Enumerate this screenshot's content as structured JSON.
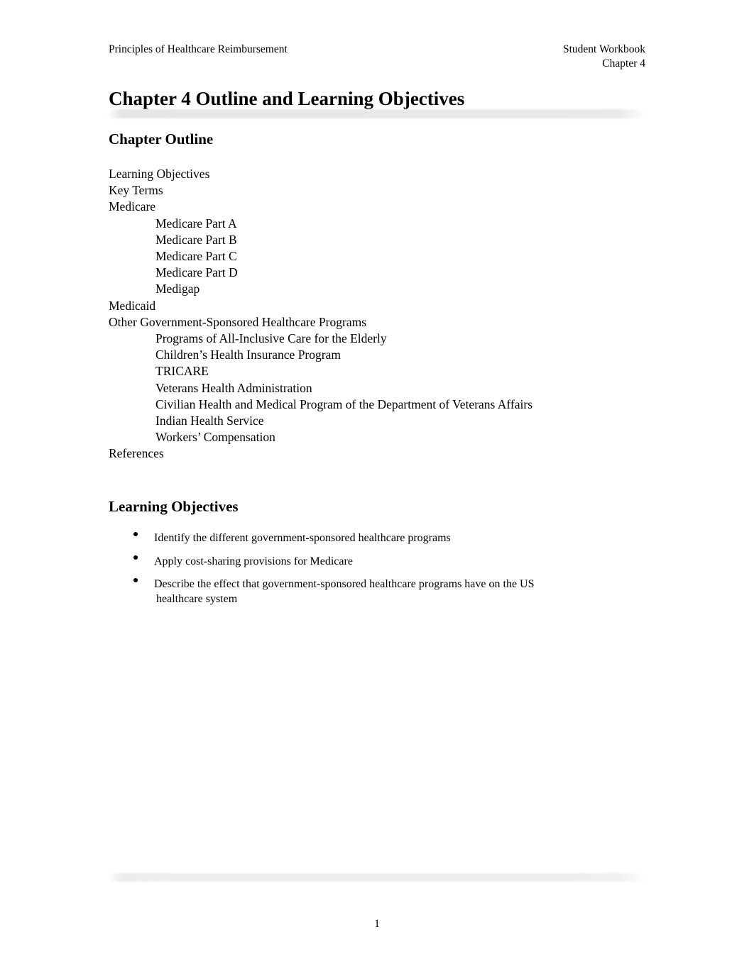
{
  "document": {
    "header": {
      "left": "Principles of Healthcare Reimbursement",
      "right_line1": "Student Workbook",
      "right_line2": "Chapter 4"
    },
    "title": "Chapter 4 Outline and Learning Objectives",
    "footer": {
      "page_number": "1"
    },
    "sections": {
      "chapter_outline": {
        "heading": "Chapter Outline",
        "items": [
          {
            "level": 0,
            "text": "Learning Objectives"
          },
          {
            "level": 0,
            "text": "Key Terms"
          },
          {
            "level": 0,
            "text": "Medicare"
          },
          {
            "level": 1,
            "text": "Medicare Part A"
          },
          {
            "level": 1,
            "text": "Medicare Part B"
          },
          {
            "level": 1,
            "text": "Medicare Part C"
          },
          {
            "level": 1,
            "text": "Medicare Part D"
          },
          {
            "level": 1,
            "text": "Medigap"
          },
          {
            "level": 0,
            "text": "Medicaid"
          },
          {
            "level": 0,
            "text": "Other Government-Sponsored Healthcare Programs"
          },
          {
            "level": 1,
            "text": "Programs of All-Inclusive Care for the Elderly"
          },
          {
            "level": 1,
            "text": "Children’s Health Insurance Program"
          },
          {
            "level": 1,
            "text": "TRICARE"
          },
          {
            "level": 1,
            "text": "Veterans Health Administration"
          },
          {
            "level": 1,
            "text": "Civilian Health and Medical Program of the Department of Veterans Affairs"
          },
          {
            "level": 1,
            "text": "Indian Health Service"
          },
          {
            "level": 1,
            "text": "Workers’ Compensation"
          },
          {
            "level": 0,
            "text": "References"
          }
        ]
      },
      "learning_objectives": {
        "heading": "Learning Objectives",
        "bullets": [
          {
            "line1": "Identify the different government-sponsored healthcare programs",
            "line2": ""
          },
          {
            "line1": "Apply cost-sharing provisions for Medicare",
            "line2": ""
          },
          {
            "line1": "Describe the effect that government-sponsored healthcare programs have on the US",
            "line2": "healthcare system"
          }
        ]
      }
    }
  }
}
